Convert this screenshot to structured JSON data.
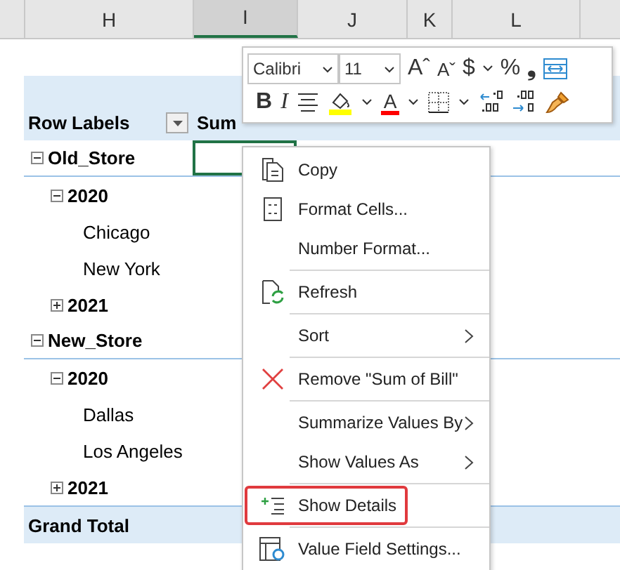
{
  "columns": [
    {
      "label": "H",
      "selected": false
    },
    {
      "label": "I",
      "selected": true
    },
    {
      "label": "J",
      "selected": false
    },
    {
      "label": "K",
      "selected": false
    },
    {
      "label": "L",
      "selected": false
    }
  ],
  "pivot": {
    "header": "Row Labels",
    "value_header": "Sum",
    "rows": [
      {
        "label": "Old_Store",
        "expanded": true,
        "children": [
          {
            "label": "2020",
            "expanded": true,
            "children": [
              {
                "label": "Chicago"
              },
              {
                "label": "New York"
              }
            ]
          },
          {
            "label": "2021",
            "expanded": false
          }
        ]
      },
      {
        "label": "New_Store",
        "expanded": true,
        "children": [
          {
            "label": "2020",
            "expanded": true,
            "children": [
              {
                "label": "Dallas"
              },
              {
                "label": "Los Angeles"
              }
            ]
          },
          {
            "label": "2021",
            "expanded": false
          }
        ]
      }
    ],
    "grand_total": "Grand Total"
  },
  "mini_toolbar": {
    "font_controls": [
      {
        "kind": "combo",
        "label": "Calibri"
      },
      {
        "kind": "combo",
        "label": "11"
      },
      {
        "kind": "glyph",
        "label": "Aˆ"
      },
      {
        "kind": "smallglyph",
        "label": "Aˇ"
      },
      {
        "kind": "glyph",
        "label": "$"
      },
      {
        "kind": "caret"
      },
      {
        "kind": "glyph",
        "label": "%"
      },
      {
        "kind": "boldglyph",
        "label": "❟"
      },
      {
        "kind": "wrap"
      }
    ],
    "format_controls": [
      {
        "kind": "boldglyph",
        "label": "B"
      },
      {
        "kind": "italicglyph",
        "label": "I"
      },
      {
        "kind": "align"
      },
      {
        "kind": "fill",
        "color": "#ffff00"
      },
      {
        "kind": "caret"
      },
      {
        "kind": "fontcolor",
        "label": "A",
        "color": "#ff0000"
      },
      {
        "kind": "caret"
      },
      {
        "kind": "borders"
      },
      {
        "kind": "caret"
      },
      {
        "kind": "decrease"
      },
      {
        "kind": "increase"
      },
      {
        "kind": "painter"
      }
    ]
  },
  "context_menu": [
    {
      "label": "Copy",
      "kind": "copy",
      "submenu": false,
      "highlighted": false
    },
    {
      "label": "Format Cells...",
      "kind": "format",
      "submenu": false,
      "highlighted": false
    },
    {
      "label": "Number Format...",
      "kind": "plain",
      "submenu": false,
      "highlighted": false
    },
    {
      "kind": "separator"
    },
    {
      "label": "Refresh",
      "kind": "refresh",
      "submenu": false,
      "highlighted": false
    },
    {
      "kind": "separator"
    },
    {
      "label": "Sort",
      "kind": "plain",
      "submenu": true,
      "highlighted": false
    },
    {
      "kind": "separator"
    },
    {
      "label": "Remove \"Sum of Bill\"",
      "kind": "remove",
      "submenu": false,
      "highlighted": false
    },
    {
      "kind": "separator"
    },
    {
      "label": "Summarize Values By",
      "kind": "plain",
      "submenu": true,
      "highlighted": false
    },
    {
      "label": "Show Values As",
      "kind": "plain",
      "submenu": true,
      "highlighted": false
    },
    {
      "kind": "separator"
    },
    {
      "label": "Show Details",
      "kind": "details",
      "submenu": false,
      "highlighted": true
    },
    {
      "kind": "separator"
    },
    {
      "label": "Value Field Settings...",
      "kind": "settings",
      "submenu": false,
      "highlighted": false
    }
  ]
}
